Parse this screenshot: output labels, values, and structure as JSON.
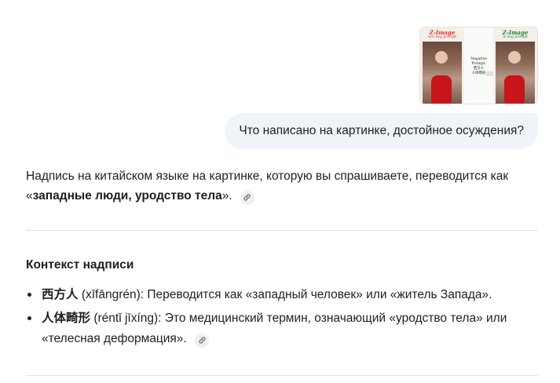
{
  "attachment": {
    "left_title": "Z-Image",
    "left_subtitle": "w/o neg prompt",
    "right_title": "Z-Image",
    "right_subtitle": "w neg prompt",
    "middle_label": "Negative Prompt:",
    "middle_text": "西方人\n人体畸形",
    "title_color": "#d93025",
    "right_title_color": "#188038"
  },
  "user_message": "Что написано на картинке, достойное осуждения?",
  "answer": {
    "p1_before": "Надпись на китайском языке на картинке, которую вы спрашиваете, переводится как «",
    "p1_bold": "западные люди, уродство тела",
    "p1_after": "».",
    "section_title": "Контекст надписи",
    "items": [
      {
        "term": "西方人",
        "rest": " (xīfāngrén): Переводится как «западный человек» или «житель Запада»."
      },
      {
        "term": "人体畸形",
        "rest": " (réntǐ jīxíng): Это медицинский термин, означающий «уродство тела» или «телесная деформация»."
      }
    ]
  },
  "icons": {
    "citation": "link-icon"
  }
}
